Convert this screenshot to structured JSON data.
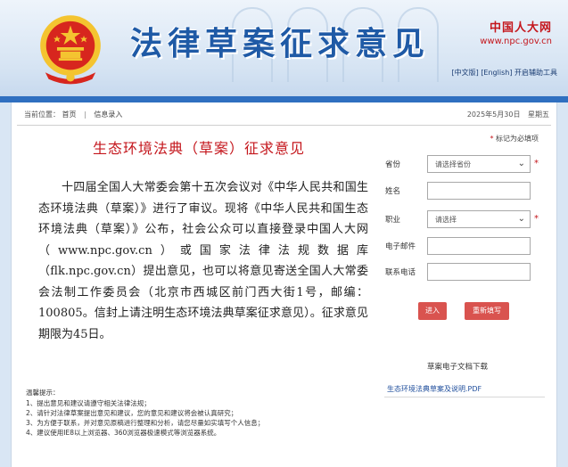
{
  "header": {
    "title": "法律草案征求意见",
    "brand_name": "中国人大网",
    "brand_url": "www.npc.gov.cn",
    "links": [
      "[中文版]",
      "[English]",
      "开启辅助工具"
    ],
    "colors": {
      "title": "#1f5aa6",
      "brand": "#c4161c",
      "strip": "#2f6fc0"
    }
  },
  "breadcrumb": {
    "prefix": "当前位置：",
    "items": [
      "首页",
      "信息录入"
    ]
  },
  "date": {
    "text": "2025年5月30日",
    "weekday": "星期五"
  },
  "document": {
    "title": "生态环境法典（草案）征求意见",
    "body": "十四届全国人大常委会第十五次会议对《中华人民共和国生态环境法典（草案）》进行了审议。现将《中华人民共和国生态环境法典（草案）》公布，社会公众可以直接登录中国人大网（www.npc.gov.cn）或国家法律法规数据库（flk.npc.gov.cn）提出意见，也可以将意见寄送全国人大常委会法制工作委员会（北京市西城区前门西大街1号，邮编：100805。信封上请注明生态环境法典草案征求意见）。征求意见期限为45日。"
  },
  "tips": {
    "heading": "温馨提示：",
    "items": [
      "1、提出意见和建议请遵守相关法律法规；",
      "2、请针对法律草案提出意见和建议，您的意见和建议将会被认真研究；",
      "3、为方便于联系，并对意见原稿进行整理和分析，请您尽量如实填写个人信息；",
      "4、建议使用IE8以上浏览器、360浏览器极速模式等浏览器系统。"
    ]
  },
  "form": {
    "note_star": "*",
    "note_text": "标记为必填项",
    "province_label": "省份",
    "province_value": "请选择省份",
    "name_label": "姓名",
    "occupation_label": "职业",
    "occupation_value": "请选择",
    "email_label": "电子邮件",
    "phone_label": "联系电话",
    "submit_label": "进入",
    "reset_label": "重新填写",
    "required_mark": "*"
  },
  "downloads": {
    "title": "草案电子文档下载",
    "link": "生态环境法典草案及说明.PDF"
  }
}
